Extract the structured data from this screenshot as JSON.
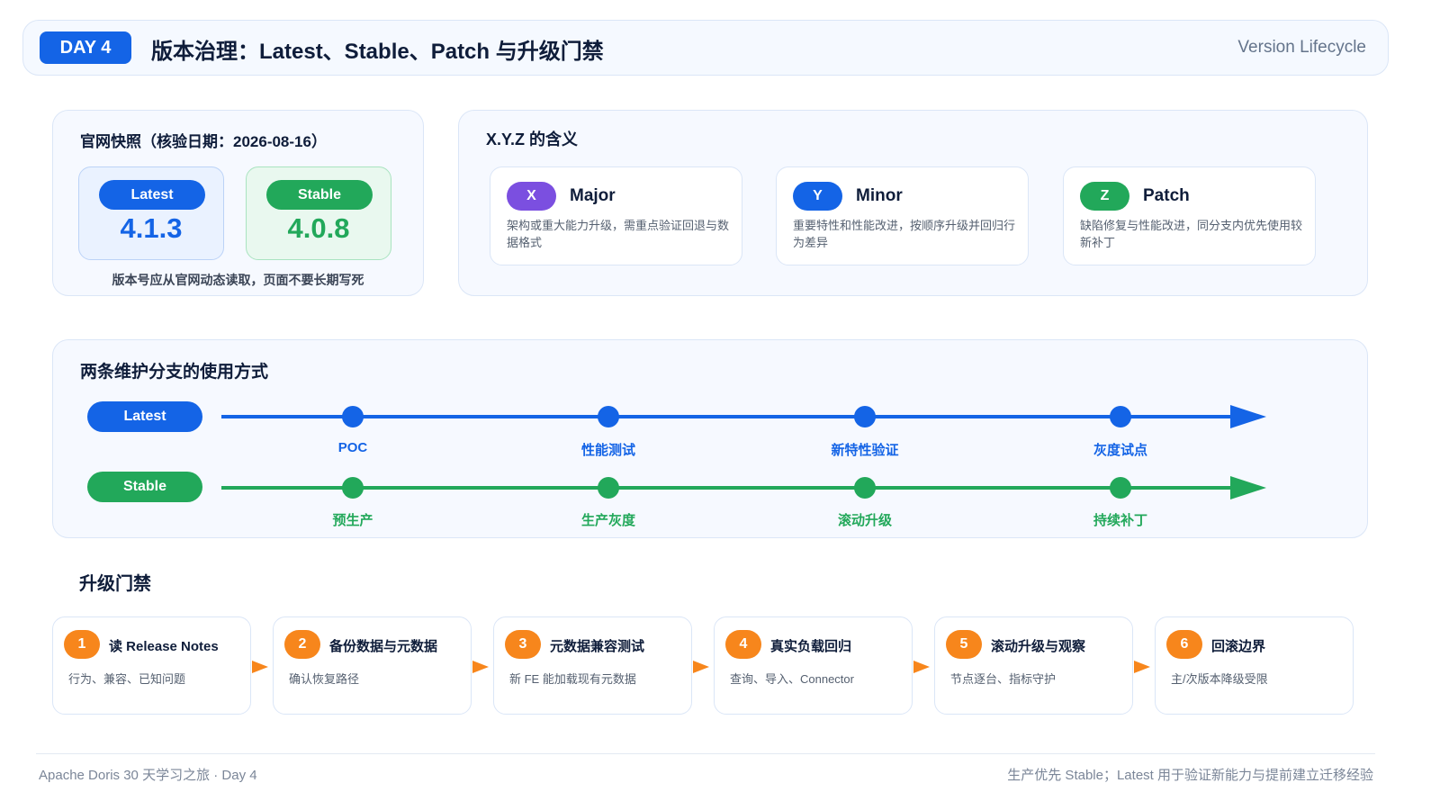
{
  "header": {
    "day_badge": "DAY 4",
    "title": "版本治理：Latest、Stable、Patch 与升级门禁",
    "subtitle": "Version Lifecycle"
  },
  "snapshot": {
    "title": "官网快照（核验日期：2026-08-16）",
    "latest_label": "Latest",
    "latest_version": "4.1.3",
    "stable_label": "Stable",
    "stable_version": "4.0.8",
    "note": "版本号应从官网动态读取，页面不要长期写死"
  },
  "xyz": {
    "title": "X.Y.Z 的含义",
    "items": [
      {
        "letter": "X",
        "name": "Major",
        "desc": "架构或重大能力升级，需重点验证回退与数据格式",
        "color": "#7b4fe0"
      },
      {
        "letter": "Y",
        "name": "Minor",
        "desc": "重要特性和性能改进，按顺序升级并回归行为差异",
        "color": "#1464e6"
      },
      {
        "letter": "Z",
        "name": "Patch",
        "desc": "缺陷修复与性能改进，同分支内优先使用较新补丁",
        "color": "#22a85a"
      }
    ]
  },
  "branches": {
    "title": "两条维护分支的使用方式",
    "latest": {
      "label": "Latest",
      "color": "#1464e6",
      "stages": [
        "POC",
        "性能测试",
        "新特性验证",
        "灰度试点"
      ]
    },
    "stable": {
      "label": "Stable",
      "color": "#22a85a",
      "stages": [
        "预生产",
        "生产灰度",
        "滚动升级",
        "持续补丁"
      ]
    }
  },
  "gate": {
    "title": "升级门禁",
    "accent": "#f7861c",
    "steps": [
      {
        "num": "1",
        "title": "读 Release Notes",
        "desc": "行为、兼容、已知问题"
      },
      {
        "num": "2",
        "title": "备份数据与元数据",
        "desc": "确认恢复路径"
      },
      {
        "num": "3",
        "title": "元数据兼容测试",
        "desc": "新 FE 能加载现有元数据"
      },
      {
        "num": "4",
        "title": "真实负载回归",
        "desc": "查询、导入、Connector"
      },
      {
        "num": "5",
        "title": "滚动升级与观察",
        "desc": "节点逐台、指标守护"
      },
      {
        "num": "6",
        "title": "回滚边界",
        "desc": "主/次版本降级受限"
      }
    ]
  },
  "footer": {
    "left": "Apache Doris 30 天学习之旅 · Day 4",
    "right": "生产优先 Stable；Latest 用于验证新能力与提前建立迁移经验"
  }
}
